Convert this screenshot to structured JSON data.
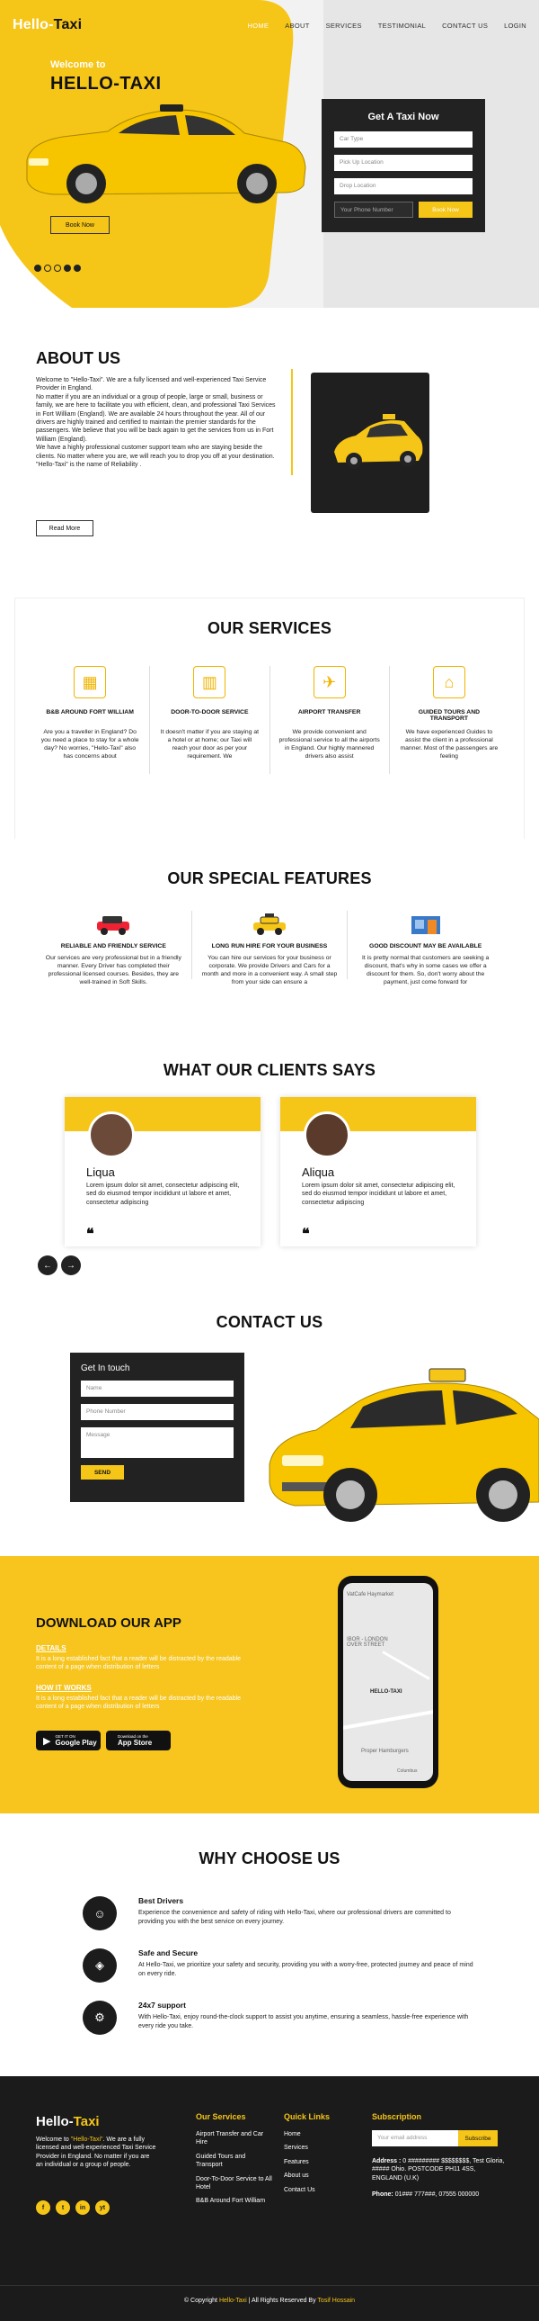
{
  "nav": {
    "logo_a": "Hello-",
    "logo_b": "Taxi",
    "items": [
      "HOME",
      "ABOUT",
      "SERVICES",
      "TESTIMONIAL",
      "CONTACT US",
      "LOGIN"
    ]
  },
  "hero": {
    "subtitle": "Welcome to",
    "title": "HELLO-TAXI",
    "cta": "Book Now",
    "form_title": "Get A Taxi Now",
    "car_type": "Car Type",
    "pickup": "Pick Up Location",
    "drop": "Drop Location",
    "phone": "Your Phone Number",
    "book": "Book Now"
  },
  "about": {
    "title": "ABOUT US",
    "text": "Welcome to \"Hello-Taxi\". We are a fully licensed and well-experienced Taxi Service Provider in England.\nNo matter if you are an individual or a group of people, large or small, business or family, we are here to facilitate you with efficient, clean, and professional Taxi Services in Fort William (England). We are available 24 hours throughout the year. All of our drivers are highly trained and certified to maintain the premier standards for the passengers. We believe that you will be back again to get the services from us in Fort William (England).\nWe have a highly professional customer support team who are staying beside the clients. No matter where you are, we will reach you to drop you off at your destination.\n\"Hello-Taxi\" is the name of Reliability .",
    "button": "Read More"
  },
  "services": {
    "title": "OUR SERVICES",
    "items": [
      {
        "title": "B&B AROUND FORT WILLIAM",
        "text": "Are you a traveller in England? Do you need a place to stay for a whole day? No worries, \"Hello-Taxi\" also has concerns about",
        "icon": "map-icon"
      },
      {
        "title": "DOOR-TO-DOOR SERVICE",
        "text": "It doesn't matter if you are staying at a hotel or at home; our Taxi will reach your door as per your requirement. We",
        "icon": "building-icon"
      },
      {
        "title": "AIRPORT TRANSFER",
        "text": "We provide convenient and professional service to all the airports in England. Our highly mannered drivers also assist",
        "icon": "airport-map-icon"
      },
      {
        "title": "GUIDED TOURS AND TRANSPORT",
        "text": "We have experienced Guides to assist the client in a professional manner. Most of the passengers are feeling",
        "icon": "tour-bag-icon"
      }
    ]
  },
  "features": {
    "title": "OUR SPECIAL FEATURES",
    "items": [
      {
        "title": "RELIABLE AND FRIENDLY SERVICE",
        "text": "Our services are very professional but in a friendly manner. Every Driver has completed their professional licensed courses. Besides, they are well-trained in Soft Skills."
      },
      {
        "title": "LONG RUN HIRE FOR YOUR BUSINESS",
        "text": "You can hire our services for your business or corporate. We provide Drivers and Cars for a month and more in a convenient way. A small step from your side can ensure a"
      },
      {
        "title": "GOOD DISCOUNT MAY BE AVAILABLE",
        "text": "It is pretty normal that customers are seeking a discount, that's why in some cases we offer a discount for them. So, don't worry about the payment, just come forward for"
      }
    ]
  },
  "clients": {
    "title": "WHAT OUR CLIENTS SAYS",
    "cards": [
      {
        "name": "Liqua",
        "text": "Lorem ipsum dolor sit amet, consectetur adipiscing elit, sed do eiusmod tempor incididunt ut labore et amet, consectetur adipiscing"
      },
      {
        "name": "Aliqua",
        "text": "Lorem ipsum dolor sit amet, consectetur adipiscing elit, sed do eiusmod tempor incididunt ut labore et amet, consectetur adipiscing"
      }
    ],
    "prev": "←",
    "next": "→"
  },
  "contact": {
    "title": "CONTACT US",
    "form_title": "Get In touch",
    "name": "Name",
    "phone": "Phone Number",
    "message": "Message",
    "send": "SEND"
  },
  "app": {
    "title": "DOWNLOAD OUR APP",
    "details_h": "DETAILS",
    "details_p": "It is a long established fact that a reader will be distracted by the readable content of a page when distribution of letters",
    "how_h": "HOW IT WORKS",
    "how_p": "It is a long established fact that a reader will be distracted by the readable content of a page when distribution of letters",
    "gp_small": "GET IT ON",
    "gp_big": "Google Play",
    "as_small": "Download on the",
    "as_big": "App Store",
    "map_label": "HELLO-TAXI",
    "map_top": "VatCafe Haymarket",
    "map_mid": "IBOR - LONDON\nOVER STREET",
    "map_bottom": "Proper Hamburgers",
    "map_corner": "Columbus"
  },
  "why": {
    "title": "WHY CHOOSE US",
    "items": [
      {
        "title": "Best Drivers",
        "text": "Experience the convenience and safety of riding with Hello-Taxi, where our professional drivers are committed to providing you with the best service on every journey."
      },
      {
        "title": "Safe and Secure",
        "text": "At Hello-Taxi, we prioritize your safety and security, providing you with a worry-free, protected journey and peace of mind on every ride."
      },
      {
        "title": "24x7 support",
        "text": "With Hello-Taxi, enjoy round-the-clock support to assist you anytime, ensuring a seamless, hassle-free experience with every ride you take."
      }
    ]
  },
  "footer": {
    "logo_a": "Hello-",
    "logo_b": "Taxi",
    "about_a": "Welcome to ",
    "about_b": "\"Hello-Taxi\"",
    "about_c": ". We are a fully licensed and well-experienced Taxi Service Provider in England. No matter if you are an individual or a group of people.",
    "social": [
      "f",
      "t",
      "in",
      "yt"
    ],
    "services_h": "Our Services",
    "services": [
      "Airport Transfer and Car Hire",
      "Guided Tours and Transport",
      "Door-To-Door Service to All Hotel",
      "B&B Around Fort William"
    ],
    "links_h": "Quick Links",
    "links": [
      "Home",
      "Services",
      "Features",
      "About us",
      "Contact Us"
    ],
    "sub_h": "Subscription",
    "email_ph": "Your email address",
    "sub_btn": "Subscribe",
    "addr_label": "Address :",
    "addr": "0 ######### $$$$$$$$, Test Gloria, ##### Ohio. POSTCODE PH11 4SS, ENGLAND (U.K)",
    "phone_label": "Phone:",
    "phone": "01### 777###, 07555 000000",
    "copy_a": "© Copyright ",
    "copy_b": "Hello-Taxi",
    "copy_c": " | All Rights Reserved By ",
    "copy_d": "Tosif Hossain"
  },
  "colors": {
    "accent": "#f5c518",
    "dark": "#1b1b1b"
  }
}
